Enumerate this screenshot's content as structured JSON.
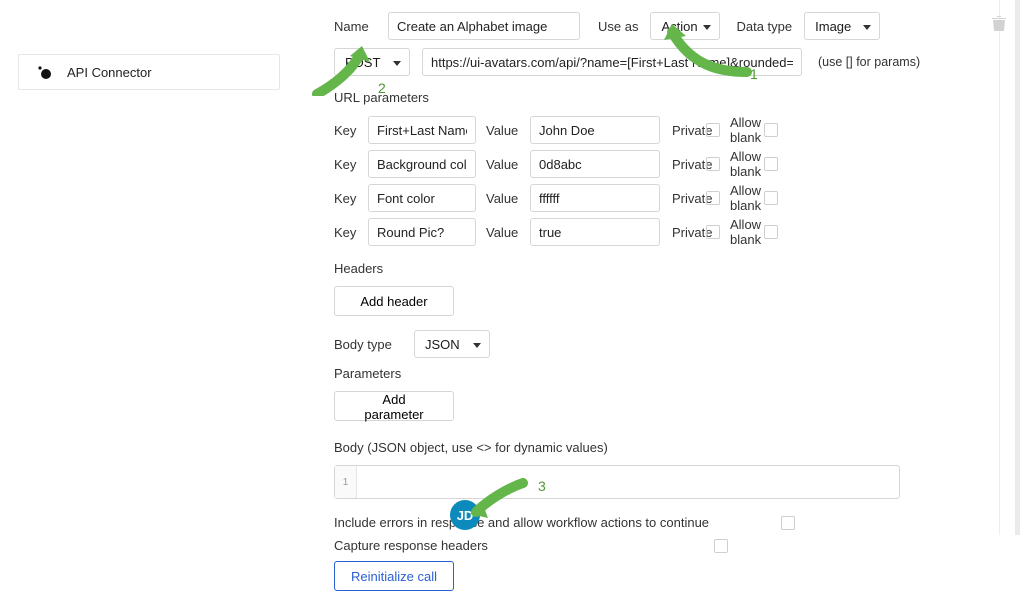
{
  "sidebar": {
    "plugin_name": "API Connector"
  },
  "call": {
    "name_label": "Name",
    "name_value": "Create an Alphabet image",
    "use_as_label": "Use as",
    "use_as_value": "Action",
    "data_type_label": "Data type",
    "data_type_value": "Image",
    "method": "POST",
    "url": "https://ui-avatars.com/api/?name=[First+Last Name]&rounded=[Round Pic?]",
    "url_hint": "(use [] for params)"
  },
  "params": {
    "title": "URL parameters",
    "key_label": "Key",
    "value_label": "Value",
    "private_label": "Private",
    "allow_blank_label": "Allow blank",
    "rows": [
      {
        "key": "First+Last Name",
        "value": "John Doe"
      },
      {
        "key": "Background color",
        "value": "0d8abc"
      },
      {
        "key": "Font color",
        "value": "ffffff"
      },
      {
        "key": "Round Pic?",
        "value": "true"
      }
    ]
  },
  "headers": {
    "title": "Headers",
    "add_btn": "Add header"
  },
  "bodytype": {
    "label": "Body type",
    "value": "JSON"
  },
  "parameters": {
    "title": "Parameters",
    "add_btn": "Add parameter"
  },
  "body": {
    "label": "Body (JSON object, use <> for dynamic values)",
    "line_no": "1"
  },
  "options": {
    "include_errors": "Include errors in response and allow workflow actions to continue",
    "capture_headers": "Capture response headers"
  },
  "actions": {
    "reinit": "Reinitialize call"
  },
  "avatar": {
    "initials": "JD"
  },
  "annotations": {
    "n1": "1",
    "n2": "2",
    "n3": "3"
  }
}
